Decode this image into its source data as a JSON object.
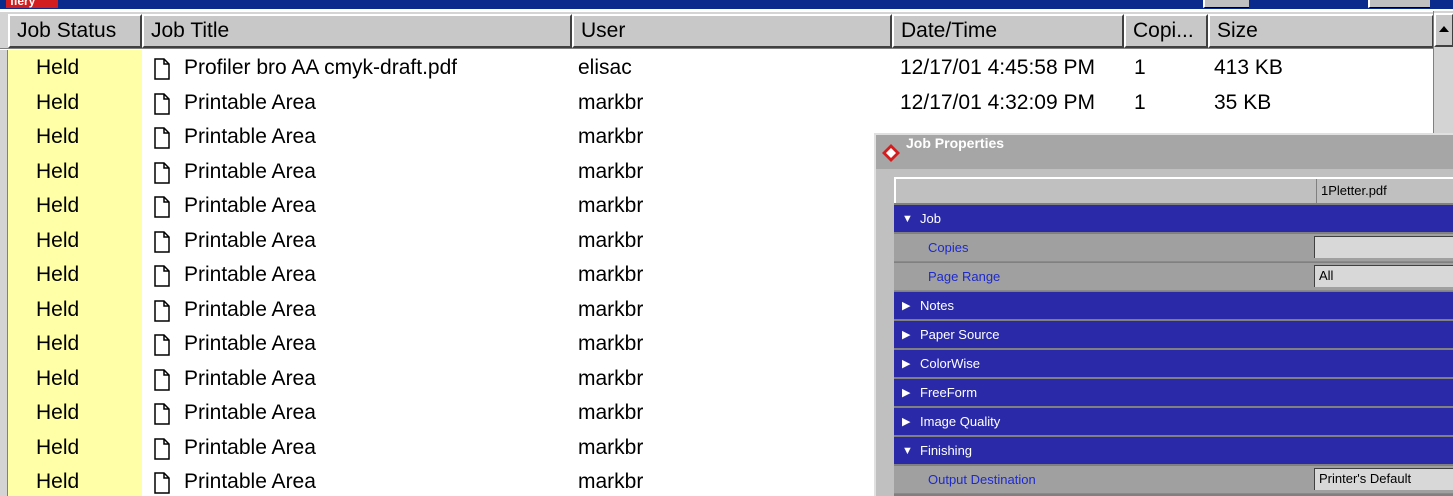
{
  "app": {
    "logo_text": "fiery"
  },
  "columns": [
    "Job Status",
    "Job Title",
    "User",
    "Date/Time",
    "Copi...",
    "Size"
  ],
  "jobs": [
    {
      "status": "Held",
      "title": "Profiler bro AA cmyk-draft.pdf",
      "user": "elisac",
      "datetime": "12/17/01 4:45:58 PM",
      "copies": "1",
      "size": "413 KB"
    },
    {
      "status": "Held",
      "title": "Printable Area",
      "user": "markbr",
      "datetime": "12/17/01 4:32:09 PM",
      "copies": "1",
      "size": "35 KB"
    },
    {
      "status": "Held",
      "title": "Printable Area",
      "user": "markbr"
    },
    {
      "status": "Held",
      "title": "Printable Area",
      "user": "markbr"
    },
    {
      "status": "Held",
      "title": "Printable Area",
      "user": "markbr"
    },
    {
      "status": "Held",
      "title": "Printable Area",
      "user": "markbr"
    },
    {
      "status": "Held",
      "title": "Printable Area",
      "user": "markbr"
    },
    {
      "status": "Held",
      "title": "Printable Area",
      "user": "markbr"
    },
    {
      "status": "Held",
      "title": "Printable Area",
      "user": "markbr"
    },
    {
      "status": "Held",
      "title": "Printable Area",
      "user": "markbr"
    },
    {
      "status": "Held",
      "title": "Printable Area",
      "user": "markbr"
    },
    {
      "status": "Held",
      "title": "Printable Area",
      "user": "markbr"
    },
    {
      "status": "Held",
      "title": "Printable Area",
      "user": "markbr"
    }
  ],
  "dialog": {
    "title": "Job Properties",
    "file_name": "1Pletter.pdf",
    "rows": [
      {
        "kind": "section",
        "expanded": true,
        "label": "Job"
      },
      {
        "kind": "prop",
        "label": "Copies",
        "value": ""
      },
      {
        "kind": "prop",
        "label": "Page Range",
        "value": "All"
      },
      {
        "kind": "section",
        "expanded": false,
        "label": "Notes"
      },
      {
        "kind": "section",
        "expanded": false,
        "label": "Paper Source"
      },
      {
        "kind": "section",
        "expanded": false,
        "label": "ColorWise"
      },
      {
        "kind": "section",
        "expanded": false,
        "label": "FreeForm"
      },
      {
        "kind": "section",
        "expanded": false,
        "label": "Image Quality"
      },
      {
        "kind": "section",
        "expanded": true,
        "label": "Finishing"
      },
      {
        "kind": "prop",
        "label": "Output Destination",
        "value": "Printer's Default"
      }
    ]
  },
  "colors": {
    "status_highlight": "#ffffa8",
    "section_blue": "#2a2aa8",
    "title_bar": "#0a2a8c"
  }
}
